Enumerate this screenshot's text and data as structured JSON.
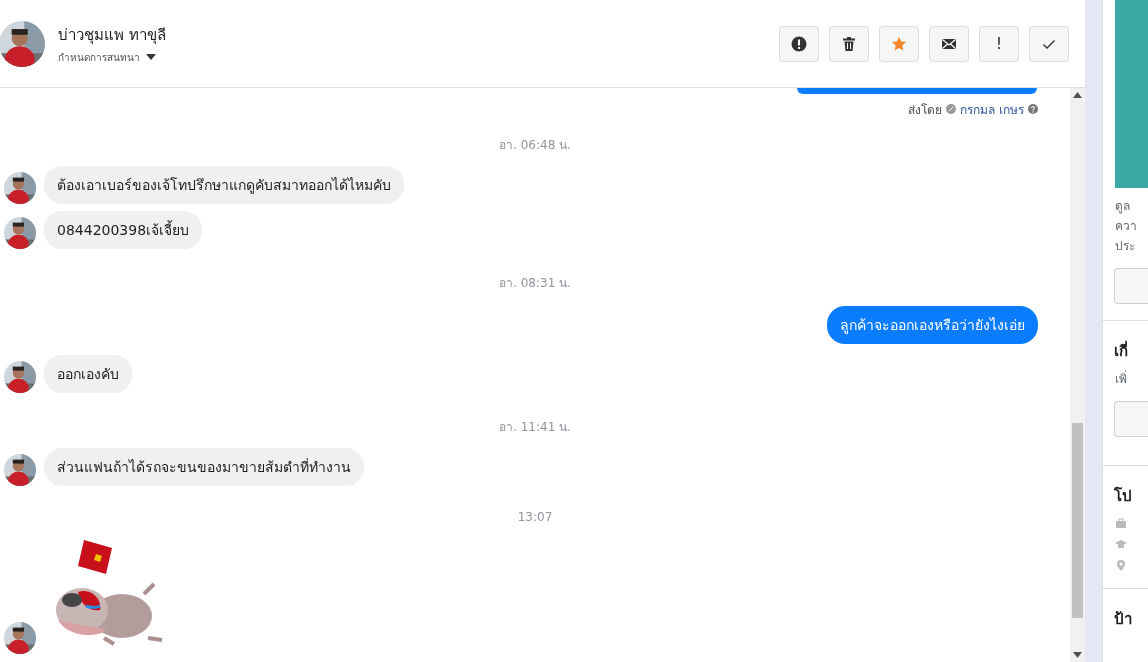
{
  "header": {
    "name": "บ่าวชุมแพ ทาขุลี",
    "subtitle": "กำหนดการสนทนา",
    "actions": [
      {
        "kind": "alert"
      },
      {
        "kind": "trash"
      },
      {
        "kind": "star"
      },
      {
        "kind": "mail"
      },
      {
        "kind": "exclaim",
        "text": "!"
      },
      {
        "kind": "check"
      }
    ]
  },
  "sent_by": {
    "label": "ส่งโดย",
    "agent": "กรกมล เกษร"
  },
  "messages": [
    {
      "kind": "time",
      "text": "อา. 06:48 น."
    },
    {
      "kind": "in",
      "text": "ต้องเอาเบอร์ของเจ้โทปรึกษาแกดูคับสมาทออกได้ไหมคับ"
    },
    {
      "kind": "in",
      "text": "0844200398เจ้เจี้ยบ"
    },
    {
      "kind": "time",
      "text": "อา. 08:31 น."
    },
    {
      "kind": "out",
      "text": "ลูกค้าจะออกเองหรือว่ายังไงเอ่ย"
    },
    {
      "kind": "in",
      "text": "ออกเองคับ"
    },
    {
      "kind": "time",
      "text": "อา. 11:41 น."
    },
    {
      "kind": "in",
      "text": "ส่วนแฟนถ้าได้รถจะขนของมาขายส้มตำที่ทำงาน"
    },
    {
      "kind": "time",
      "text": "13:07"
    },
    {
      "kind": "sticker"
    }
  ],
  "side_panel": {
    "lines": [
      "ดูล",
      "ควา",
      "ประ"
    ],
    "sections": [
      {
        "kind": "button",
        "title": "เกี่",
        "text": "เพิ่"
      },
      {
        "kind": "details",
        "title": "โป"
      },
      {
        "kind": "plain",
        "title": "ป้า"
      }
    ]
  }
}
